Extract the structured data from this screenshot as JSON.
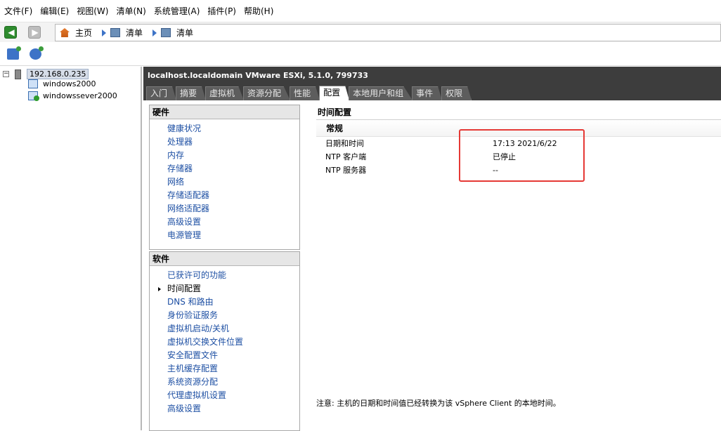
{
  "menu": [
    "文件(F)",
    "编辑(E)",
    "视图(W)",
    "清单(N)",
    "系统管理(A)",
    "插件(P)",
    "帮助(H)"
  ],
  "nav": {
    "breadcrumbs": [
      "主页",
      "清单",
      "清单"
    ]
  },
  "tree": {
    "host": "192.168.0.235",
    "expander": "−",
    "vms": [
      "windows2000",
      "windowssever2000"
    ]
  },
  "header": {
    "title": "localhost.localdomain VMware ESXi, 5.1.0, 799733",
    "tabs": [
      "入门",
      "摘要",
      "虚拟机",
      "资源分配",
      "性能",
      "配置",
      "本地用户和组",
      "事件",
      "权限"
    ],
    "active_tab_index": 5
  },
  "hardware": {
    "heading": "硬件",
    "items": [
      "健康状况",
      "处理器",
      "内存",
      "存储器",
      "网络",
      "存储适配器",
      "网络适配器",
      "高级设置",
      "电源管理"
    ]
  },
  "software": {
    "heading": "软件",
    "items": [
      "已获许可的功能",
      "时间配置",
      "DNS 和路由",
      "身份验证服务",
      "虚拟机启动/关机",
      "虚拟机交换文件位置",
      "安全配置文件",
      "主机缓存配置",
      "系统资源分配",
      "代理虚拟机设置",
      "高级设置"
    ],
    "selected_index": 1
  },
  "detail": {
    "title": "时间配置",
    "section": "常规",
    "rows": [
      {
        "key": "日期和时间",
        "value": "17:13  2021/6/22"
      },
      {
        "key": "NTP 客户端",
        "value": "已停止"
      },
      {
        "key": "NTP 服务器",
        "value": "--"
      }
    ],
    "note": "注意: 主机的日期和时间值已经转换为该 vSphere Client 的本地时间。"
  },
  "colors": {
    "highlight": "#e53935",
    "link": "#1d4fa3",
    "header_bg": "#3d3d3d"
  }
}
